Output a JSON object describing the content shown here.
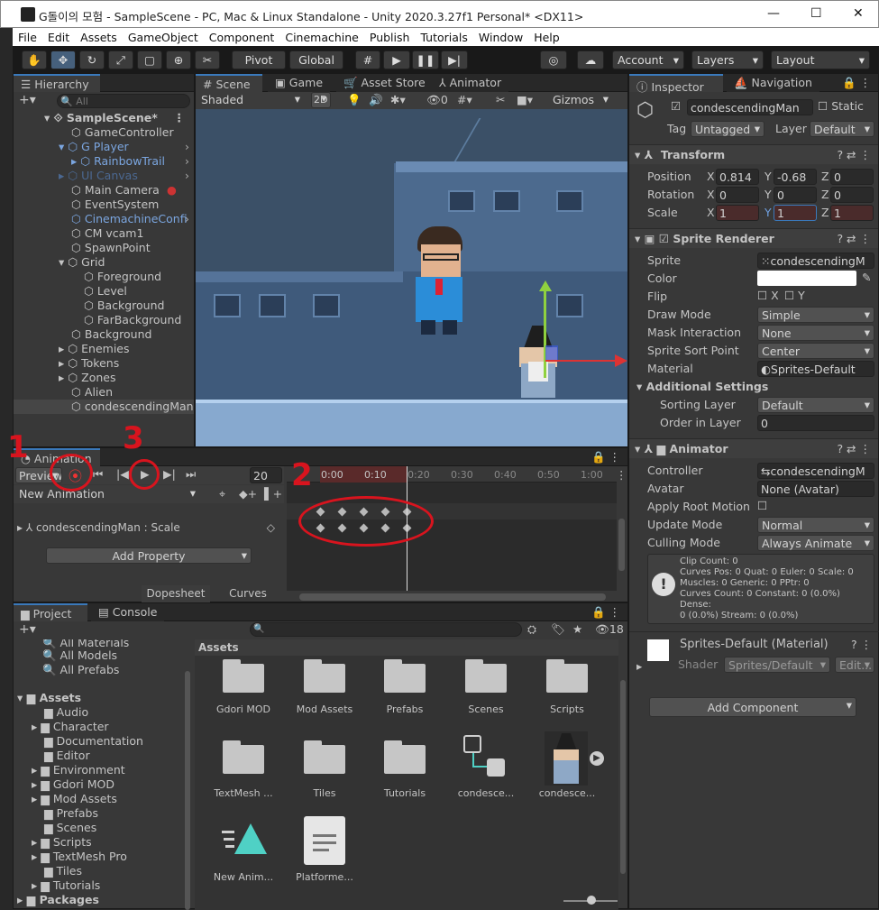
{
  "title": "G돌이의 모험 - SampleScene - PC, Mac & Linux Standalone - Unity 2020.3.27f1 Personal* <DX11>",
  "menu": [
    "File",
    "Edit",
    "Assets",
    "GameObject",
    "Component",
    "Cinemachine",
    "Publish",
    "Tutorials",
    "Window",
    "Help"
  ],
  "toolbar": {
    "pivot": "Pivot",
    "global": "Global",
    "account": "Account",
    "layers": "Layers",
    "layout": "Layout"
  },
  "hierarchy": {
    "tab": "Hierarchy",
    "search_placeholder": "All",
    "scene": "SampleScene*",
    "items": [
      "GameController",
      "G Player",
      "RainbowTrail",
      "UI Canvas",
      "Main Camera",
      "EventSystem",
      "CinemachineConfi",
      "CM vcam1",
      "SpawnPoint",
      "Grid",
      "Foreground",
      "Level",
      "Background",
      "FarBackground",
      "Background",
      "Enemies",
      "Tokens",
      "Zones",
      "Alien",
      "condescendingMan"
    ]
  },
  "scene": {
    "tabs": [
      "Scene",
      "Game",
      "Asset Store",
      "Animator"
    ],
    "shading": "Shaded",
    "mode2d": "2D",
    "gizmos": "Gizmos",
    "hidden": "0"
  },
  "animation": {
    "tab": "Animation",
    "preview": "Preview",
    "frame": "20",
    "clip": "New Animation",
    "times": [
      "0:00",
      "0:10",
      "0:20",
      "0:30",
      "0:40",
      "0:50",
      "1:00"
    ],
    "property": "condescendingMan : Scale",
    "add_property": "Add Property",
    "dopesheet": "Dopesheet",
    "curves": "Curves"
  },
  "annotations": [
    "1",
    "2",
    "3"
  ],
  "project": {
    "tabs": [
      "Project",
      "Console"
    ],
    "count": "18",
    "favorites": [
      "All Materials",
      "All Models",
      "All Prefabs"
    ],
    "assets_root": "Assets",
    "tree": [
      "Audio",
      "Character",
      "Documentation",
      "Editor",
      "Environment",
      "Gdori MOD",
      "Mod Assets",
      "Prefabs",
      "Scenes",
      "Scripts",
      "TextMesh Pro",
      "Tiles",
      "Tutorials"
    ],
    "packages": "Packages",
    "header": "Assets",
    "grid": [
      "Gdori MOD",
      "Mod Assets",
      "Prefabs",
      "Scenes",
      "Scripts",
      "TextMesh ...",
      "Tiles",
      "Tutorials",
      "condesce...",
      "condesce...",
      "New Anim...",
      "Platforme..."
    ]
  },
  "inspector": {
    "tabs": [
      "Inspector",
      "Navigation"
    ],
    "name": "condescendingMan",
    "static": "Static",
    "tag_label": "Tag",
    "tag": "Untagged",
    "layer_label": "Layer",
    "layer": "Default",
    "transform": {
      "title": "Transform",
      "position": [
        "0.814",
        "-0.68",
        "0"
      ],
      "rotation": [
        "0",
        "0",
        "0"
      ],
      "scale": [
        "1",
        "1",
        "1"
      ],
      "labels": [
        "Position",
        "Rotation",
        "Scale"
      ]
    },
    "sprite_renderer": {
      "title": "Sprite Renderer",
      "sprite": "condescendingM",
      "draw_mode": "Simple",
      "mask": "None",
      "sort_point": "Center",
      "material": "Sprites-Default",
      "sorting_layer": "Default",
      "order": "0",
      "labels": [
        "Sprite",
        "Color",
        "Flip",
        "Draw Mode",
        "Mask Interaction",
        "Sprite Sort Point",
        "Material"
      ],
      "additional": "Additional Settings",
      "sorting_label": "Sorting Layer",
      "order_label": "Order in Layer"
    },
    "animator": {
      "title": "Animator",
      "controller": "condescendingM",
      "avatar": "None (Avatar)",
      "update": "Normal",
      "culling": "Always Animate",
      "labels": [
        "Controller",
        "Avatar",
        "Apply Root Motion",
        "Update Mode",
        "Culling Mode"
      ],
      "info": [
        "Clip Count: 0",
        "Curves Pos: 0 Quat: 0 Euler: 0 Scale: 0",
        "Muscles: 0 Generic: 0 PPtr: 0",
        "Curves Count: 0 Constant: 0 (0.0%) Dense:",
        "0 (0.0%) Stream: 0 (0.0%)"
      ]
    },
    "material": {
      "title": "Sprites-Default (Material)",
      "shader_label": "Shader",
      "shader": "Sprites/Default",
      "edit": "Edit..."
    },
    "add_component": "Add Component"
  }
}
